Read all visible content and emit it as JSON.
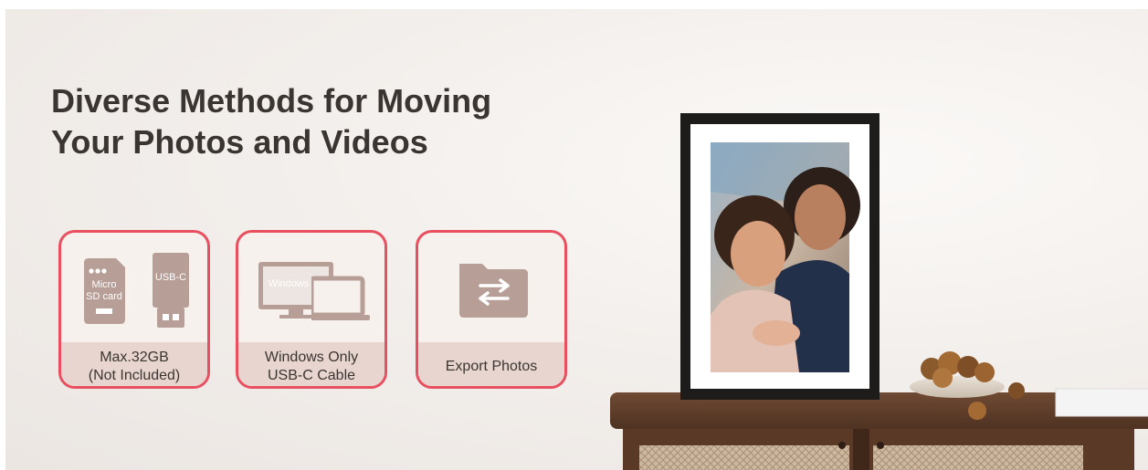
{
  "headline": {
    "line1": "Diverse Methods for Moving",
    "line2": "Your Photos and Videos"
  },
  "cards": [
    {
      "icons": [
        "micro-sd-card-icon",
        "usb-c-drive-icon"
      ],
      "icon_text": {
        "sd": "Micro SD card",
        "usb": "USB-C"
      },
      "caption_line1": "Max.32GB",
      "caption_line2": "(Not Included)"
    },
    {
      "icons": [
        "desktop-monitor-icon",
        "laptop-icon"
      ],
      "icon_text": {
        "monitor": "Windows"
      },
      "caption_line1": "Windows Only",
      "caption_line2": "USB-C Cable"
    },
    {
      "icons": [
        "folder-transfer-icon"
      ],
      "caption_line1": "Export Photos"
    }
  ],
  "colors": {
    "accent": "#e8505f",
    "icon": "#b79e97",
    "caption_bg": "#e8d5cf",
    "text": "#3b3531"
  },
  "scene": {
    "items": [
      "photo-frame",
      "framed-family-photo",
      "wooden-sideboard",
      "bowl-of-fruit"
    ]
  }
}
